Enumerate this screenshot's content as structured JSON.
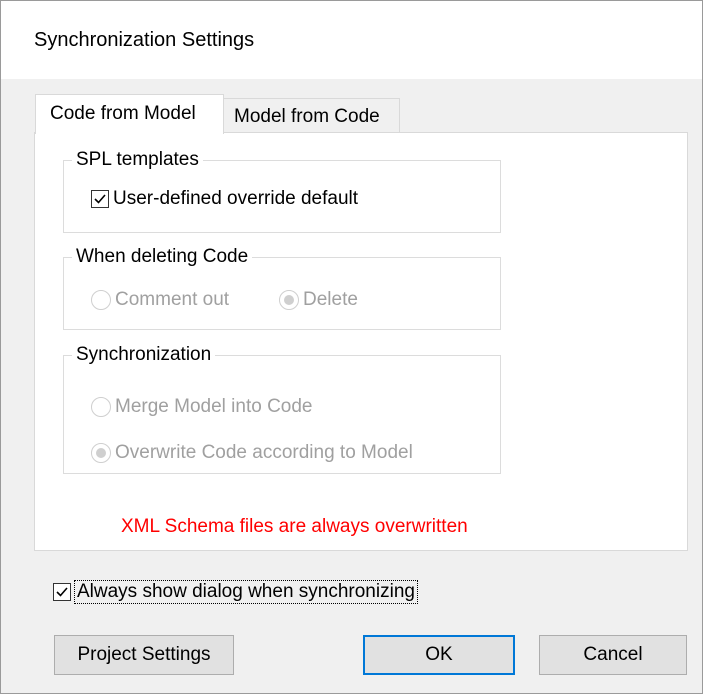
{
  "dialog": {
    "title": "Synchronization Settings",
    "tabs": [
      {
        "label": "Code from Model",
        "active": true
      },
      {
        "label": "Model from Code",
        "active": false
      }
    ],
    "spl_templates": {
      "legend": "SPL templates",
      "user_defined_override_default": {
        "label": "User-defined override default",
        "checked": true
      }
    },
    "when_deleting_code": {
      "legend": "When deleting Code",
      "options": [
        {
          "label": "Comment out",
          "selected": false,
          "enabled": false
        },
        {
          "label": "Delete",
          "selected": true,
          "enabled": false
        }
      ]
    },
    "synchronization": {
      "legend": "Synchronization",
      "options": [
        {
          "label": "Merge Model into Code",
          "selected": false,
          "enabled": false
        },
        {
          "label": "Overwrite Code according to Model",
          "selected": true,
          "enabled": false
        }
      ]
    },
    "warning": "XML Schema files are always overwritten",
    "always_show_dialog": {
      "label": "Always show dialog when synchronizing",
      "checked": true
    },
    "buttons": {
      "project_settings": "Project Settings",
      "ok": "OK",
      "cancel": "Cancel"
    },
    "colors": {
      "warning_text": "#ff0000",
      "disabled_text": "#a0a0a0",
      "default_button_border": "#0078d7"
    }
  }
}
